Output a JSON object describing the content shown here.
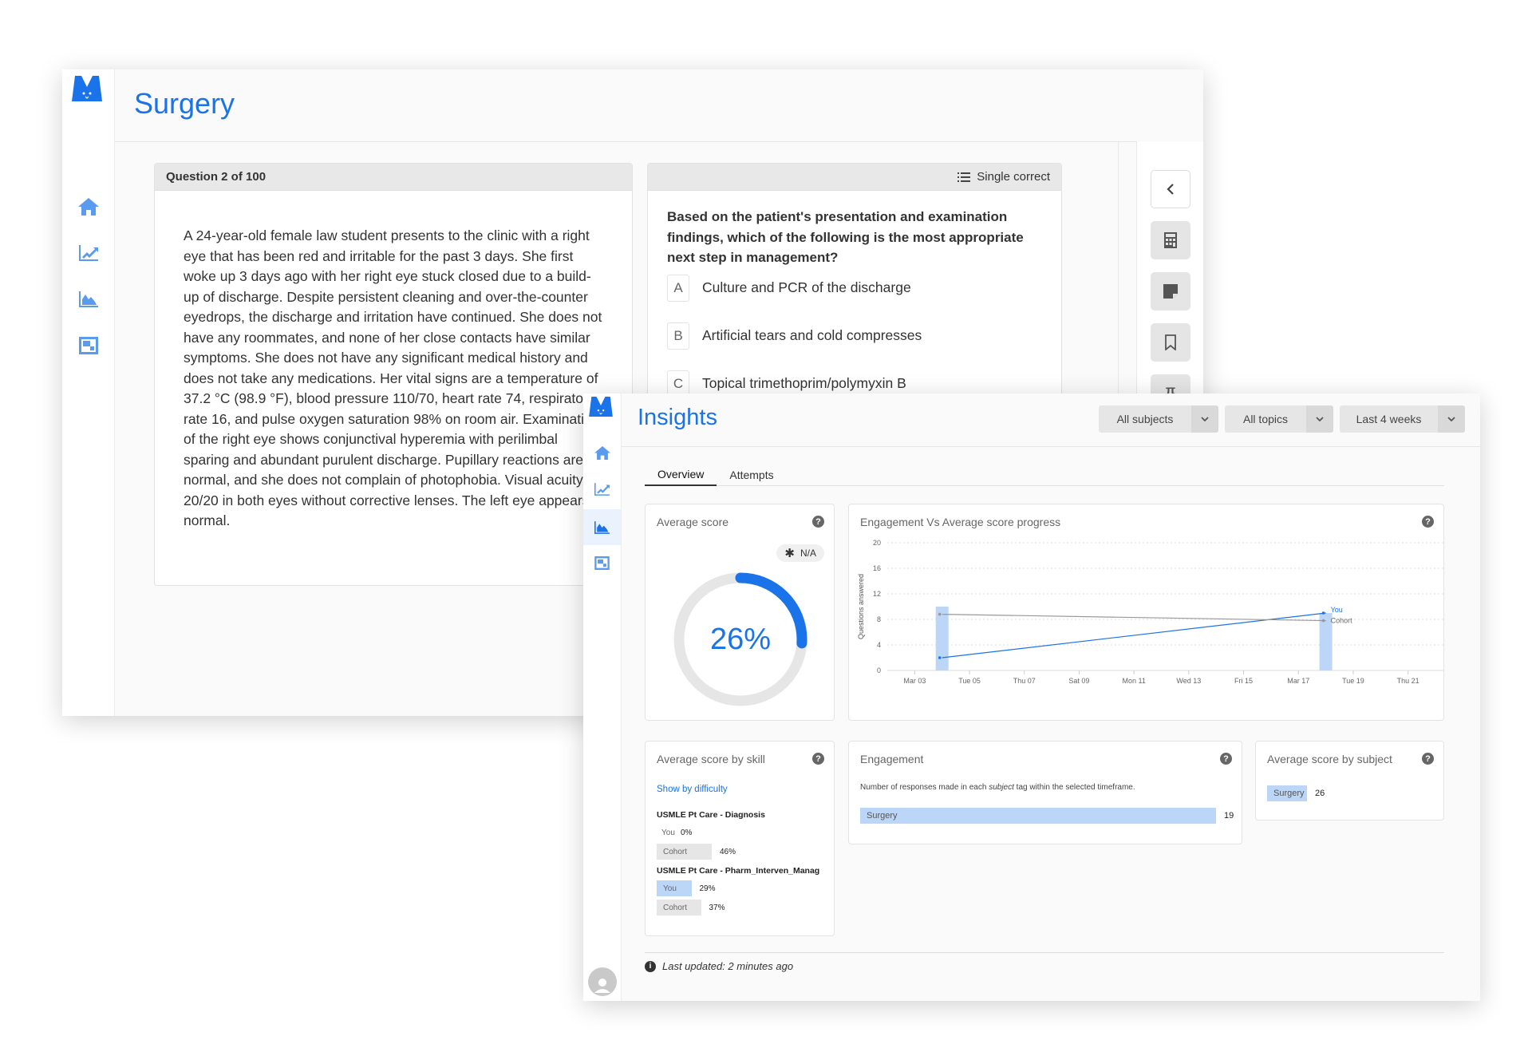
{
  "back_window": {
    "title": "Surgery",
    "nav": [
      {
        "name": "home-icon"
      },
      {
        "name": "progress-chart-icon"
      },
      {
        "name": "insights-chart-icon"
      },
      {
        "name": "bank-icon"
      }
    ],
    "question_card": {
      "header": "Question 2 of 100",
      "stem": "A 24-year-old female law student presents to the clinic with a right eye that has been red and irritable for the past 3 days. She first woke up 3 days ago with her right eye stuck closed due to a build-up of discharge. Despite persistent cleaning and over-the-counter eyedrops, the discharge and irritation have continued. She does not have any roommates, and none of her close contacts have similar symptoms. She does not have any significant medical history and does not take any medications. Her vital signs are a temperature of 37.2 °C (98.9 °F), blood pressure 110/70, heart rate 74, respiratory rate 16, and pulse oxygen saturation 98% on room air. Examination of the right eye shows conjunctival hyperemia with perilimbal sparing and abundant purulent discharge. Pupillary reactions are normal, and she does not complain of photophobia. Visual acuity is 20/20 in both eyes without corrective lenses. The left eye appears normal."
    },
    "answer_card": {
      "type_label": "Single correct",
      "question": "Based on the patient's presentation and examination findings, which of the following is the most appropriate next step in management?",
      "options": [
        {
          "letter": "A",
          "text": "Culture and PCR of the discharge"
        },
        {
          "letter": "B",
          "text": "Artificial tears and cold compresses"
        },
        {
          "letter": "C",
          "text": "Topical trimethoprim/polymyxin B"
        }
      ]
    },
    "tools": [
      "collapse-chevron-icon",
      "calculator-icon",
      "notes-icon",
      "bookmark-icon",
      "pi-icon"
    ]
  },
  "front_window": {
    "title": "Insights",
    "filters": [
      {
        "label": "All subjects"
      },
      {
        "label": "All topics"
      },
      {
        "label": "Last 4 weeks"
      }
    ],
    "tabs": [
      {
        "label": "Overview",
        "active": true
      },
      {
        "label": "Attempts",
        "active": false
      }
    ],
    "average_score": {
      "title": "Average score",
      "badge": "N/A",
      "value_label": "26%",
      "value": 26,
      "accent": "#1a73e8"
    },
    "engagement_chart": {
      "title": "Engagement Vs Average score progress"
    },
    "skill_card": {
      "title": "Average score by skill",
      "link": "Show by difficulty",
      "skills": [
        {
          "name": "USMLE Pt Care - Diagnosis",
          "you_label": "You",
          "you_value": "0%",
          "you": 0,
          "cohort_label": "Cohort",
          "cohort_value": "46%",
          "cohort": 46
        },
        {
          "name": "USMLE Pt Care - Pharm_Interven_Manag",
          "you_label": "You",
          "you_value": "29%",
          "you": 29,
          "cohort_label": "Cohort",
          "cohort_value": "37%",
          "cohort": 37
        }
      ]
    },
    "engagement_card": {
      "title": "Engagement",
      "description_pre": "Number of responses made in each ",
      "description_em": "subject",
      "description_post": " tag within the selected timeframe.",
      "bars": [
        {
          "label": "Surgery",
          "value": "19"
        }
      ]
    },
    "subject_card": {
      "title": "Average score by subject",
      "bars": [
        {
          "label": "Surgery",
          "value": "26"
        }
      ]
    },
    "footer": "Last updated: 2 minutes ago"
  },
  "chart_data": {
    "type": "bar",
    "title": "Engagement Vs Average score progress",
    "ylabel": "Questions answered",
    "xlabel": "",
    "ylim": [
      0,
      20
    ],
    "yticks": [
      "0",
      "4",
      "8",
      "12",
      "16",
      "20"
    ],
    "xticks": [
      "Mar 03",
      "Tue 05",
      "Thu 07",
      "Sat 09",
      "Mon 11",
      "Wed 13",
      "Fri 15",
      "Mar 17",
      "Tue 19",
      "Thu 21"
    ],
    "x_domain_days": [
      2,
      22
    ],
    "xtick_days": [
      3,
      5,
      7,
      9,
      11,
      13,
      15,
      17,
      19,
      21
    ],
    "bars": [
      {
        "day": 4,
        "label": "Mar 04",
        "value": 10
      },
      {
        "day": 18,
        "label": "Mar 18",
        "value": 9
      }
    ],
    "series": [
      {
        "name": "You",
        "color": "#1a73e8",
        "points": [
          {
            "day": 4,
            "value": 2
          },
          {
            "day": 18,
            "value": 9
          }
        ]
      },
      {
        "name": "Cohort",
        "color": "#999999",
        "points": [
          {
            "day": 4,
            "value": 8.8
          },
          {
            "day": 18,
            "value": 7.8
          }
        ]
      }
    ],
    "grid": true,
    "legend": "inline-right"
  }
}
